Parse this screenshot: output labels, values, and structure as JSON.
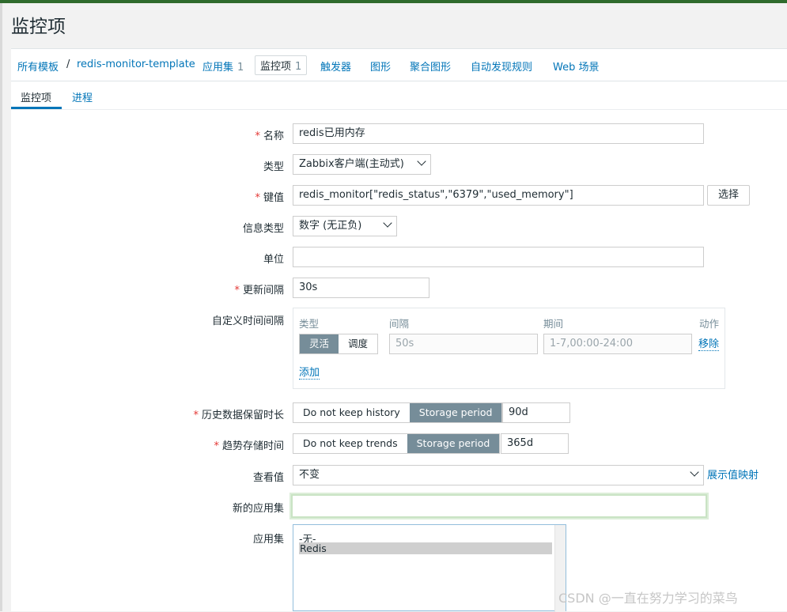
{
  "page_title": "监控项",
  "nav": {
    "all_templates": "所有模板",
    "separator": "/",
    "template_name": "redis-monitor-template",
    "applications": "应用集",
    "applications_count": "1",
    "items": "监控项",
    "items_count": "1",
    "triggers": "触发器",
    "graphs": "图形",
    "screens": "聚合图形",
    "discovery": "自动发现规则",
    "web": "Web 场景"
  },
  "tabs": [
    "监控项",
    "进程"
  ],
  "form": {
    "name_label": "名称",
    "name_value": "redis已用内存",
    "type_label": "类型",
    "type_value": "Zabbix客户端(主动式)",
    "key_label": "键值",
    "key_value": "redis_monitor[\"redis_status\",\"6379\",\"used_memory\"]",
    "key_select_button": "选择",
    "info_type_label": "信息类型",
    "info_type_value": "数字 (无正负)",
    "units_label": "单位",
    "units_value": "",
    "interval_label": "更新间隔",
    "interval_value": "30s",
    "custom_intervals_label": "自定义时间间隔",
    "custom_intervals": {
      "col_type": "类型",
      "col_interval": "间隔",
      "col_period": "期间",
      "col_action": "动作",
      "opt_flexible": "灵活",
      "opt_scheduling": "调度",
      "interval_placeholder": "50s",
      "period_placeholder": "1-7,00:00-24:00",
      "remove_link": "移除",
      "add_link": "添加"
    },
    "history_label": "历史数据保留时长",
    "history_opt_no": "Do not keep history",
    "history_opt_storage": "Storage period",
    "history_value": "90d",
    "trends_label": "趋势存储时间",
    "trends_opt_no": "Do not keep trends",
    "trends_opt_storage": "Storage period",
    "trends_value": "365d",
    "valuemap_label": "查看值",
    "valuemap_value": "不变",
    "valuemap_link": "展示值映射",
    "new_app_label": "新的应用集",
    "new_app_value": "",
    "apps_label": "应用集",
    "apps_options": [
      "-无-",
      "Redis"
    ]
  },
  "watermark": "CSDN @一直在努力学习的菜鸟",
  "colors": {
    "link": "#0275b8",
    "required": "#e33734",
    "segment_active": "#768d99",
    "top_bar": "#2f6b2d"
  }
}
